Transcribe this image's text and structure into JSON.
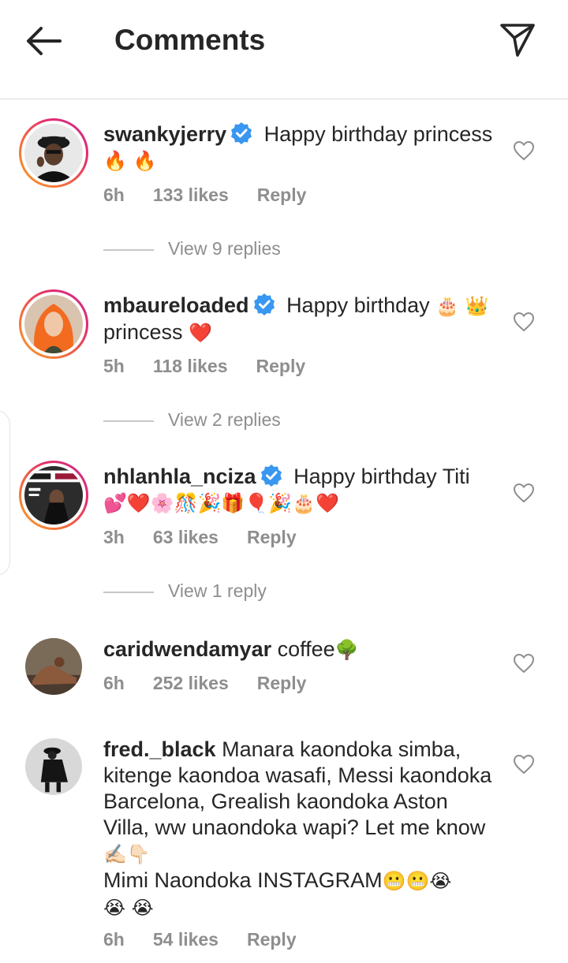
{
  "header": {
    "title": "Comments",
    "back_icon": "arrow-left-icon",
    "send_icon": "paper-plane-icon"
  },
  "colors": {
    "text": "#262626",
    "secondary": "#8e8e8e",
    "verified": "#3897f0",
    "ring_start": "#f9a32a",
    "ring_end": "#c4318f"
  },
  "comments": [
    {
      "username": "swankyjerry",
      "verified": true,
      "text": "Happy birthday princess",
      "emojis": "🔥 🔥",
      "time": "6h",
      "likes": "133 likes",
      "reply": "Reply",
      "view_replies": "View 9 replies"
    },
    {
      "username": "mbaureloaded",
      "verified": true,
      "text_before": "Happy birthday",
      "emoji_mid": "🎂",
      "emoji_crown": "👑",
      "text_after": "princess",
      "emoji_end": "❤️",
      "time": "5h",
      "likes": "118 likes",
      "reply": "Reply",
      "view_replies": "View 2 replies"
    },
    {
      "username": "nhlanhla_nciza",
      "verified": true,
      "text": "Happy birthday Titi",
      "emojis": "💕❤️🌸🎊🎉🎁🎈🎉🎂❤️",
      "time": "3h",
      "likes": "63 likes",
      "reply": "Reply",
      "view_replies": "View 1 reply"
    },
    {
      "username": "caridwendamyar",
      "verified": false,
      "text": "coffee",
      "emojis": "🌳",
      "time": "6h",
      "likes": "252 likes",
      "reply": "Reply"
    },
    {
      "username": "fred._black",
      "verified": false,
      "text": "Manara kaondoka simba, kitenge kaondoa wasafi, Messi kaondoka Barcelona, Grealish kaondoka Aston Villa, ww unaondoka wapi? Let me know",
      "emojis": "✍🏻👇🏻",
      "text2": "Mimi Naondoka INSTAGRAM",
      "emojis2": "😬😬😭",
      "emojis3": "😭 😭",
      "time": "6h",
      "likes": "54 likes",
      "reply": "Reply"
    }
  ]
}
